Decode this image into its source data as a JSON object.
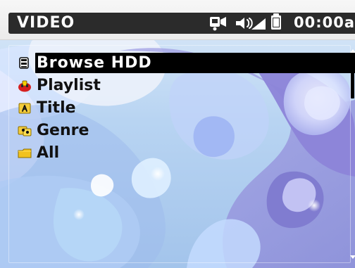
{
  "header": {
    "title": "VIDEO",
    "clock": "00:00a"
  },
  "icons": {
    "status": [
      "video-icon",
      "volume-icon",
      "signal-icon",
      "battery-icon"
    ],
    "menu": [
      "hdd-icon",
      "playlist-icon",
      "title-icon",
      "genre-icon",
      "folder-icon"
    ]
  },
  "menu": {
    "items": [
      {
        "label": "Browse HDD",
        "selected": true
      },
      {
        "label": "Playlist",
        "selected": false
      },
      {
        "label": "Title",
        "selected": false
      },
      {
        "label": "Genre",
        "selected": false
      },
      {
        "label": "All",
        "selected": false
      }
    ]
  },
  "colors": {
    "status_bg": "#2b2b2b",
    "selection_bg": "#000000",
    "background_light": "#b8d4f2",
    "background_mid": "#9fc0e8",
    "menu_text": "#111111",
    "selected_text": "#ffffff"
  },
  "scroll": {
    "position": 0
  }
}
